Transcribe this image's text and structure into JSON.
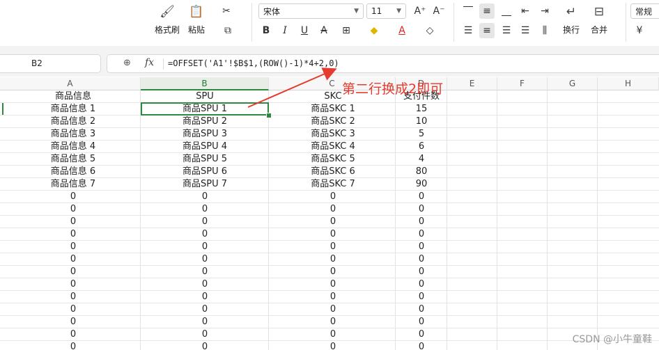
{
  "ribbon": {
    "format_painter": "格式刷",
    "paste": "粘贴",
    "font_name": "宋体",
    "font_size": "11",
    "wrap": "换行",
    "merge": "合并",
    "number_format": "常规",
    "currency_symbol": "¥"
  },
  "formula_bar": {
    "cell_ref": "B2",
    "formula": "=OFFSET('A1'!$B$1,(ROW()-1)*4+2,0)"
  },
  "columns": [
    "A",
    "B",
    "C",
    "D",
    "E",
    "F",
    "G",
    "H"
  ],
  "selected_column": "B",
  "rows": [
    [
      "商品信息",
      "SPU",
      "SKC",
      "支付件数"
    ],
    [
      "商品信息 1",
      "商品SPU 1",
      "商品SKC 1",
      "15"
    ],
    [
      "商品信息 2",
      "商品SPU 2",
      "商品SKC 2",
      "10"
    ],
    [
      "商品信息 3",
      "商品SPU 3",
      "商品SKC 3",
      "5"
    ],
    [
      "商品信息 4",
      "商品SPU 4",
      "商品SKC 4",
      "6"
    ],
    [
      "商品信息 5",
      "商品SPU 5",
      "商品SKC 5",
      "4"
    ],
    [
      "商品信息 6",
      "商品SPU 6",
      "商品SKC 6",
      "80"
    ],
    [
      "商品信息 7",
      "商品SPU 7",
      "商品SKC 7",
      "90"
    ],
    [
      "0",
      "0",
      "0",
      "0"
    ],
    [
      "0",
      "0",
      "0",
      "0"
    ],
    [
      "0",
      "0",
      "0",
      "0"
    ],
    [
      "0",
      "0",
      "0",
      "0"
    ],
    [
      "0",
      "0",
      "0",
      "0"
    ],
    [
      "0",
      "0",
      "0",
      "0"
    ],
    [
      "0",
      "0",
      "0",
      "0"
    ],
    [
      "0",
      "0",
      "0",
      "0"
    ],
    [
      "0",
      "0",
      "0",
      "0"
    ],
    [
      "0",
      "0",
      "0",
      "0"
    ],
    [
      "0",
      "0",
      "0",
      "0"
    ],
    [
      "0",
      "0",
      "0",
      "0"
    ],
    [
      "0",
      "0",
      "0",
      "0"
    ]
  ],
  "annotation": "第二行换成2即可",
  "annotation_color": "#e53b2e",
  "selection_color": "#2b8a3e",
  "watermark": "CSDN @小牛童鞋"
}
